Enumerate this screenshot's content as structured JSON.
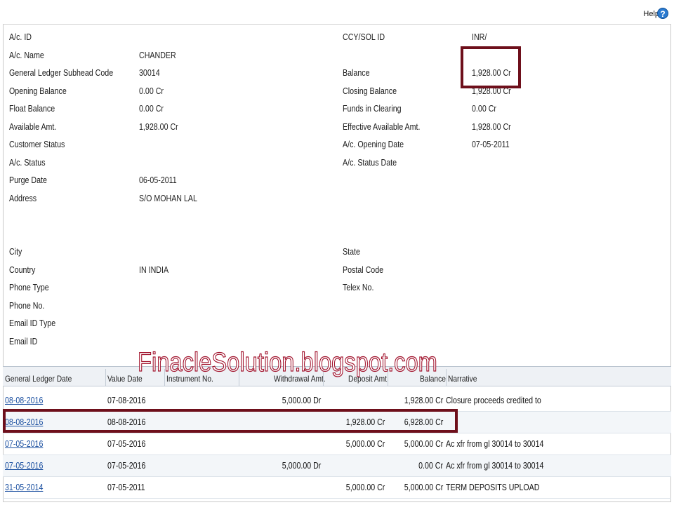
{
  "header": {
    "help_label": "Help",
    "help_icon": "?"
  },
  "account": {
    "left": [
      {
        "label": "A/c. ID",
        "value": ""
      },
      {
        "label": "A/c. Name",
        "value": "CHANDER"
      },
      {
        "label": "General Ledger Subhead Code",
        "value": "30014"
      },
      {
        "label": "Opening Balance",
        "value": "0.00 Cr"
      },
      {
        "label": "Float Balance",
        "value": "0.00 Cr"
      },
      {
        "label": "Available Amt.",
        "value": "1,928.00 Cr"
      },
      {
        "label": "Customer Status",
        "value": ""
      },
      {
        "label": "A/c. Status",
        "value": ""
      },
      {
        "label": "Purge Date",
        "value": "06-05-2011"
      },
      {
        "label": "Address",
        "value": "S/O MOHAN LAL"
      },
      {
        "label": "City",
        "value": ""
      },
      {
        "label": "Country",
        "value": "IN INDIA"
      },
      {
        "label": "Phone Type",
        "value": ""
      },
      {
        "label": "Phone No.",
        "value": ""
      },
      {
        "label": "Email ID Type",
        "value": ""
      },
      {
        "label": "Email ID",
        "value": ""
      }
    ],
    "right": [
      {
        "label": "CCY/SOL ID",
        "value": "INR/"
      },
      {
        "label": "Balance",
        "value": "1,928.00 Cr"
      },
      {
        "label": "Closing Balance",
        "value": "1,928.00 Cr"
      },
      {
        "label": "Funds in Clearing",
        "value": "0.00 Cr"
      },
      {
        "label": "Effective Available Amt.",
        "value": "1,928.00 Cr"
      },
      {
        "label": "A/c. Opening Date",
        "value": "07-05-2011"
      },
      {
        "label": "A/c. Status Date",
        "value": ""
      },
      {
        "label": "State",
        "value": ""
      },
      {
        "label": "Postal Code",
        "value": ""
      },
      {
        "label": "Telex No.",
        "value": ""
      }
    ]
  },
  "watermark": "FinacleSolution.blogspot.com",
  "transactions": {
    "columns": [
      "General Ledger Date",
      "Value Date",
      "Instrument No.",
      "Withdrawal Amt.",
      "Deposit Amt.",
      "Balance",
      "Narrative"
    ],
    "rows": [
      {
        "gl_date": "08-08-2016",
        "value_date": "07-08-2016",
        "instrument": "",
        "withdrawal": "5,000.00 Dr",
        "deposit": "",
        "balance": "1,928.00 Cr",
        "narrative": "Closure proceeds credited to"
      },
      {
        "gl_date": "08-08-2016",
        "value_date": "08-08-2016",
        "instrument": "",
        "withdrawal": "",
        "deposit": "1,928.00 Cr",
        "balance": "6,928.00 Cr",
        "narrative": ""
      },
      {
        "gl_date": "07-05-2016",
        "value_date": "07-05-2016",
        "instrument": "",
        "withdrawal": "",
        "deposit": "5,000.00 Cr",
        "balance": "5,000.00 Cr",
        "narrative": "Ac xfr from gl 30014 to 30014"
      },
      {
        "gl_date": "07-05-2016",
        "value_date": "07-05-2016",
        "instrument": "",
        "withdrawal": "5,000.00 Dr",
        "deposit": "",
        "balance": "0.00 Cr",
        "narrative": "Ac xfr from gl 30014 to 30014"
      },
      {
        "gl_date": "31-05-2014",
        "value_date": "07-05-2011",
        "instrument": "",
        "withdrawal": "",
        "deposit": "5,000.00 Cr",
        "balance": "5,000.00 Cr",
        "narrative": "TERM DEPOSITS UPLOAD"
      }
    ]
  },
  "colors": {
    "highlight_border": "#6e0f1b",
    "watermark": "#a0102a",
    "link": "#1a4fa0"
  }
}
